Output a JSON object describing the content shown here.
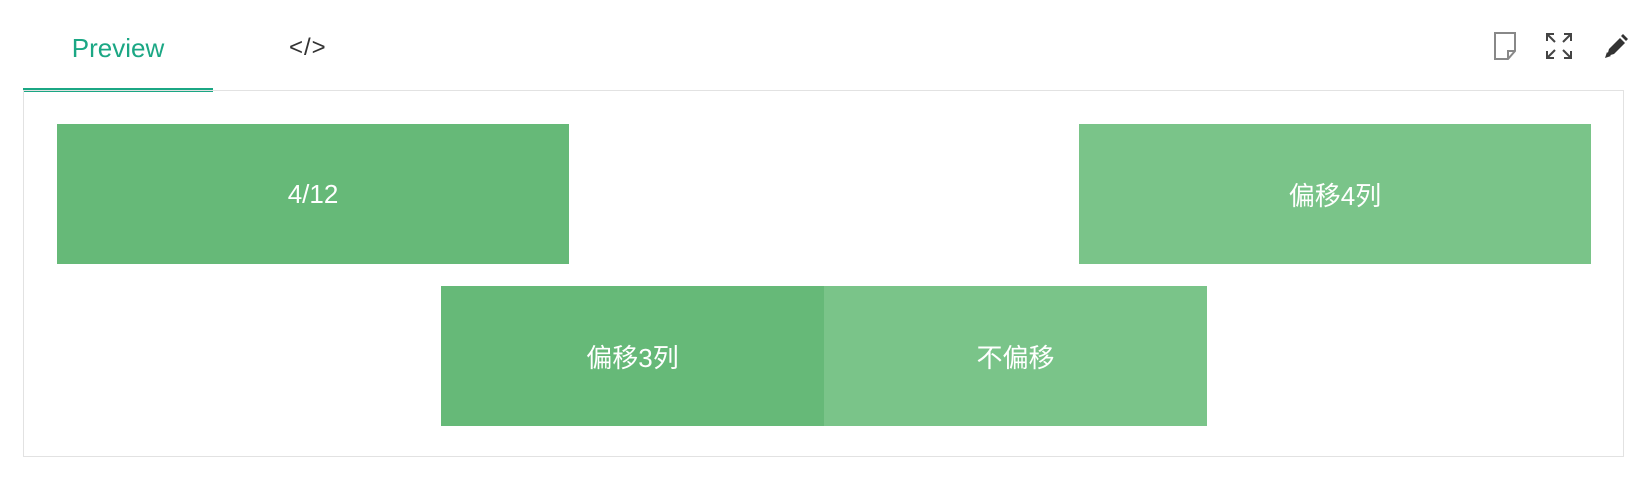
{
  "tabs": {
    "preview_label": "Preview",
    "code_label": "</>"
  },
  "toolbar": {
    "icons": [
      "note-icon",
      "fullscreen-icon",
      "edit-icon"
    ]
  },
  "grid": {
    "row1": {
      "col_a": "4/12",
      "col_b": "偏移4列"
    },
    "row2": {
      "col_a": "偏移3列",
      "col_b": "不偏移"
    }
  },
  "colors": {
    "accent": "#1ba784",
    "green_dark": "#66b978",
    "green_light": "#7ac489",
    "border": "#e2e2e2"
  }
}
